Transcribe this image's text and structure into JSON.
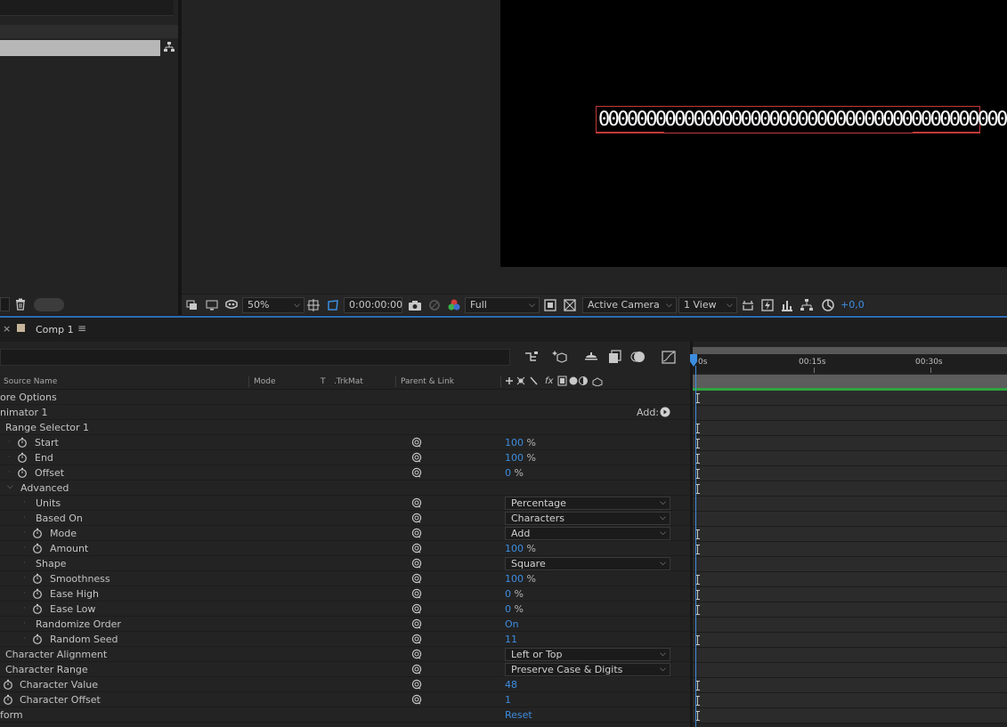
{
  "viewer": {
    "text_layer": "0000000000000000000000000000000000000000000000",
    "zoom": "50%",
    "timecode": "0:00:00:00",
    "resolution": "Full",
    "camera": "Active Camera",
    "views": "1 View",
    "exposure": "+0,0"
  },
  "timeline": {
    "tab_close": "×",
    "comp_tab": "Comp 1",
    "tab_menu": "≡",
    "columns": {
      "source_name": "Source Name",
      "mode": "Mode",
      "t": "T",
      "trkmat": ".TrkMat",
      "parent_link": "Parent & Link",
      "fx": "fx"
    },
    "ruler": {
      "t0": "0s",
      "t15": "00:15s",
      "t30": "00:30s"
    },
    "rows": {
      "more_options": "ore Options",
      "animator": "nimator 1",
      "add_label": "Add:",
      "range_selector": "Range Selector 1",
      "start": {
        "label": "Start",
        "value": "100",
        "unit": "%"
      },
      "end": {
        "label": "End",
        "value": "100",
        "unit": "%"
      },
      "offset": {
        "label": "Offset",
        "value": "0",
        "unit": "%"
      },
      "advanced": "Advanced",
      "units": {
        "label": "Units",
        "value": "Percentage"
      },
      "based_on": {
        "label": "Based On",
        "value": "Characters"
      },
      "mode": {
        "label": "Mode",
        "value": "Add"
      },
      "amount": {
        "label": "Amount",
        "value": "100",
        "unit": "%"
      },
      "shape": {
        "label": "Shape",
        "value": "Square"
      },
      "smoothness": {
        "label": "Smoothness",
        "value": "100",
        "unit": "%"
      },
      "ease_high": {
        "label": "Ease High",
        "value": "0",
        "unit": "%"
      },
      "ease_low": {
        "label": "Ease Low",
        "value": "0",
        "unit": "%"
      },
      "randomize_order": {
        "label": "Randomize Order",
        "value": "On"
      },
      "random_seed": {
        "label": "Random Seed",
        "value": "11"
      },
      "char_alignment": {
        "label": "Character Alignment",
        "value": "Left or Top"
      },
      "char_range": {
        "label": "Character Range",
        "value": "Preserve Case & Digits"
      },
      "char_value": {
        "label": "Character Value",
        "value": "48"
      },
      "char_offset": {
        "label": "Character Offset",
        "value": "1"
      },
      "transform": {
        "label": "form",
        "value": "Reset"
      }
    }
  },
  "colors": {
    "accent_blue": "#3c8de0",
    "duration_green": "#2ea43f",
    "selection_red": "#c23a3a"
  }
}
